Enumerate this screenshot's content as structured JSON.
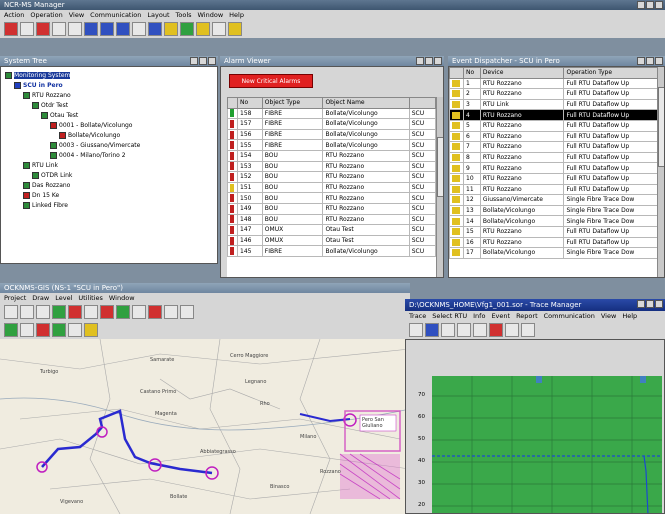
{
  "app": {
    "title": "NCR-MS Manager",
    "menu": [
      "Action",
      "Operation",
      "View",
      "Communication",
      "Layout",
      "Tools",
      "Window",
      "Help"
    ]
  },
  "system_tree": {
    "title": "System Tree",
    "items": [
      {
        "label": "Monitoring System",
        "indent": 0,
        "color": "#2e8b3a",
        "selected": true
      },
      {
        "label": "SCU in Pero",
        "indent": 1,
        "color": "#2040c0",
        "bold": true
      },
      {
        "label": "RTU Rozzano",
        "indent": 2,
        "color": "#2e8b3a"
      },
      {
        "label": "Otdr Test",
        "indent": 3,
        "color": "#2e8b3a"
      },
      {
        "label": "Otau Test",
        "indent": 4,
        "color": "#2e8b3a"
      },
      {
        "label": "0001 - Bollate/Vicolungo",
        "indent": 5,
        "color": "#c02020"
      },
      {
        "label": "Bollate/Vicolungo",
        "indent": 6,
        "color": "#c02020"
      },
      {
        "label": "0003 - Giussano/Vimercate",
        "indent": 5,
        "color": "#2e8b3a"
      },
      {
        "label": "0004 - Milano/Torino 2",
        "indent": 5,
        "color": "#2e8b3a"
      },
      {
        "label": "RTU Link",
        "indent": 2,
        "color": "#2e8b3a"
      },
      {
        "label": "OTDR Link",
        "indent": 3,
        "color": "#2e8b3a"
      },
      {
        "label": "Das Rozzano",
        "indent": 2,
        "color": "#2e8b3a"
      },
      {
        "label": "Dn 15 Ke",
        "indent": 2,
        "color": "#c02020"
      },
      {
        "label": "Linked Fibre",
        "indent": 2,
        "color": "#2e8b3a"
      }
    ]
  },
  "alarm_viewer": {
    "title": "Alarm Viewer",
    "banner": "New Critical Alarms",
    "columns": [
      "No",
      "Object Type",
      "Object Name",
      ""
    ],
    "rows": [
      {
        "no": "158",
        "type": "FIBRE",
        "name": "Bollate/Vicolungo",
        "extra": "SCU",
        "flag": "#20a030"
      },
      {
        "no": "157",
        "type": "FIBRE",
        "name": "Bollate/Vicolungo",
        "extra": "SCU",
        "flag": "#c02020"
      },
      {
        "no": "156",
        "type": "FIBRE",
        "name": "Bollate/Vicolungo",
        "extra": "SCU",
        "flag": "#c02020"
      },
      {
        "no": "155",
        "type": "FIBRE",
        "name": "Bollate/Vicolungo",
        "extra": "SCU",
        "flag": "#c02020"
      },
      {
        "no": "154",
        "type": "BOU",
        "name": "RTU Rozzano",
        "extra": "SCU",
        "flag": "#c02020"
      },
      {
        "no": "153",
        "type": "BOU",
        "name": "RTU Rozzano",
        "extra": "SCU",
        "flag": "#c02020"
      },
      {
        "no": "152",
        "type": "BOU",
        "name": "RTU Rozzano",
        "extra": "SCU",
        "flag": "#c02020"
      },
      {
        "no": "151",
        "type": "BOU",
        "name": "RTU Rozzano",
        "extra": "SCU",
        "flag": "#e0c020"
      },
      {
        "no": "150",
        "type": "BOU",
        "name": "RTU Rozzano",
        "extra": "SCU",
        "flag": "#c02020"
      },
      {
        "no": "149",
        "type": "BOU",
        "name": "RTU Rozzano",
        "extra": "SCU",
        "flag": "#c02020"
      },
      {
        "no": "148",
        "type": "BOU",
        "name": "RTU Rozzano",
        "extra": "SCU",
        "flag": "#c02020"
      },
      {
        "no": "147",
        "type": "OMUX",
        "name": "Otau Test",
        "extra": "SCU",
        "flag": "#c02020"
      },
      {
        "no": "146",
        "type": "OMUX",
        "name": "Otau Test",
        "extra": "SCU",
        "flag": "#c02020"
      },
      {
        "no": "145",
        "type": "FIBRE",
        "name": "Bollate/Vicolungo",
        "extra": "SCU",
        "flag": "#c02020"
      }
    ]
  },
  "event_dispatcher": {
    "title": "Event Dispatcher - SCU in Pero",
    "columns": [
      "",
      "No",
      "Device",
      "Operation Type"
    ],
    "rows": [
      {
        "no": "1",
        "device": "RTU Rozzano",
        "op": "Full RTU Dataflow Up",
        "selected": false
      },
      {
        "no": "2",
        "device": "RTU Rozzano",
        "op": "Full RTU Dataflow Up",
        "selected": false
      },
      {
        "no": "3",
        "device": "RTU Link",
        "op": "Full RTU Dataflow Up",
        "selected": false
      },
      {
        "no": "4",
        "device": "RTU Rozzano",
        "op": "Full RTU Dataflow Up",
        "selected": true
      },
      {
        "no": "5",
        "device": "RTU Rozzano",
        "op": "Full RTU Dataflow Up",
        "selected": false
      },
      {
        "no": "6",
        "device": "RTU Rozzano",
        "op": "Full RTU Dataflow Up",
        "selected": false
      },
      {
        "no": "7",
        "device": "RTU Rozzano",
        "op": "Full RTU Dataflow Up",
        "selected": false
      },
      {
        "no": "8",
        "device": "RTU Rozzano",
        "op": "Full RTU Dataflow Up",
        "selected": false
      },
      {
        "no": "9",
        "device": "RTU Rozzano",
        "op": "Full RTU Dataflow Up",
        "selected": false
      },
      {
        "no": "10",
        "device": "RTU Rozzano",
        "op": "Full RTU Dataflow Up",
        "selected": false
      },
      {
        "no": "11",
        "device": "RTU Rozzano",
        "op": "Full RTU Dataflow Up",
        "selected": false
      },
      {
        "no": "12",
        "device": "Giussano/Vimercate",
        "op": "Single Fibre Trace Dow",
        "selected": false
      },
      {
        "no": "13",
        "device": "Bollate/Vicolungo",
        "op": "Single Fibre Trace Dow",
        "selected": false
      },
      {
        "no": "14",
        "device": "Bollate/Vicolungo",
        "op": "Single Fibre Trace Dow",
        "selected": false
      },
      {
        "no": "15",
        "device": "RTU Rozzano",
        "op": "Full RTU Dataflow Up",
        "selected": false
      },
      {
        "no": "16",
        "device": "RTU Rozzano",
        "op": "Full RTU Dataflow Up",
        "selected": false
      },
      {
        "no": "17",
        "device": "Bollate/Vicolungo",
        "op": "Single Fibre Trace Dow",
        "selected": false
      }
    ]
  },
  "gis": {
    "title": "OCKNMS-GIS (NS-1 \"SCU in Pero\")",
    "menu": [
      "Project",
      "Draw",
      "Level",
      "Utilities",
      "Window"
    ],
    "labels": [
      "Samarate",
      "Cerro Maggiore",
      "Legnano",
      "Castano Primo",
      "Turbigo",
      "Magenta",
      "Rho",
      "Milano",
      "Abbiategrasso",
      "Binasco",
      "Rozzano",
      "Bollate",
      "Vigevano"
    ],
    "site_label": "Pero San Giuliano"
  },
  "trace_manager": {
    "title": "D:\\OCKNMS_HOME\\Vfg1_001.sor - Trace Manager",
    "menu": [
      "Trace",
      "Select RTU",
      "Info",
      "Event",
      "Report",
      "Communication",
      "View",
      "Help"
    ],
    "y_ticks": [
      "70",
      "60",
      "50",
      "40",
      "30",
      "20"
    ]
  }
}
